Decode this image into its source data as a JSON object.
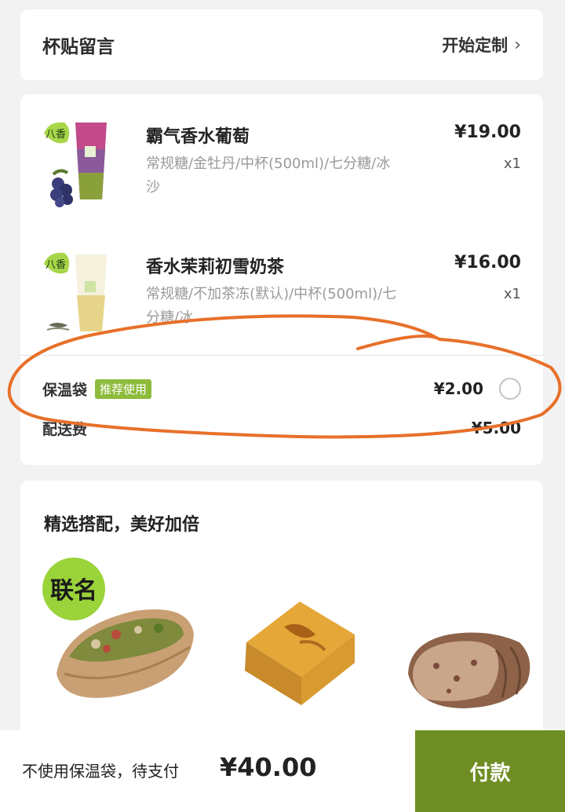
{
  "cup_note": {
    "title": "杯贴留言",
    "action_label": "开始定制"
  },
  "order": {
    "items": [
      {
        "badge": "八香",
        "name": "霸气香水葡萄",
        "spec_line1": "常规糖/金牡丹/中杯(500ml)/七分糖/冰",
        "spec_line2": "沙",
        "price": "¥19.00",
        "qty": "x1"
      },
      {
        "badge": "八香",
        "name": "香水茉莉初雪奶茶",
        "spec_line1": "常规糖/不加茶冻(默认)/中杯(500ml)/七",
        "spec_line2": "分糖/冰",
        "price": "¥16.00",
        "qty": "x1"
      }
    ],
    "insulated_bag": {
      "label": "保温袋",
      "tag": "推荐使用",
      "price": "¥2.00",
      "selected": false
    },
    "delivery_fee": {
      "label": "配送费",
      "value": "¥5.00"
    }
  },
  "recommendations": {
    "title": "精选搭配，美好加倍",
    "items": [
      {
        "badge": "联名",
        "name": "sandwich"
      },
      {
        "name": "toast"
      },
      {
        "name": "bread"
      }
    ]
  },
  "checkout": {
    "text": "不使用保温袋，待支付",
    "amount": "¥40.00",
    "pay_label": "付款"
  },
  "colors": {
    "accent": "#6e8e23",
    "tag_green": "#8dbb3c",
    "badge_green": "#a8d64a",
    "annotation_orange": "#e8702a"
  }
}
